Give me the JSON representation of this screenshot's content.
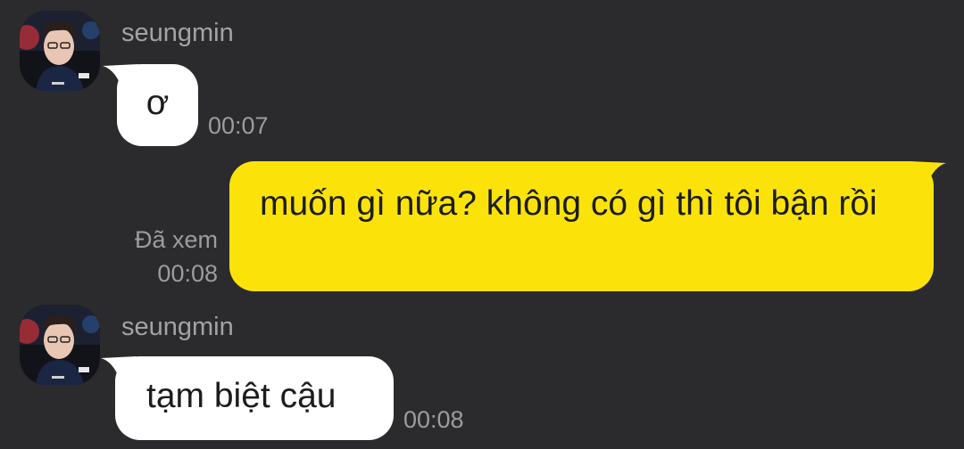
{
  "chat": {
    "messages": [
      {
        "sender": "seungmin",
        "direction": "incoming",
        "text": "ơ",
        "time": "00:07"
      },
      {
        "direction": "outgoing",
        "text": "muốn gì nữa? không có gì thì tôi bận rồi",
        "status": "Đã xem",
        "time": "00:08"
      },
      {
        "sender": "seungmin",
        "direction": "incoming",
        "text": "tạm biệt cậu",
        "time": "00:08"
      }
    ]
  },
  "colors": {
    "background": "#2b2b2d",
    "incoming_bubble": "#ffffff",
    "outgoing_bubble": "#fbe30a",
    "meta_text": "#9c9c9e"
  },
  "icons": {
    "avatar": "profile-photo"
  }
}
